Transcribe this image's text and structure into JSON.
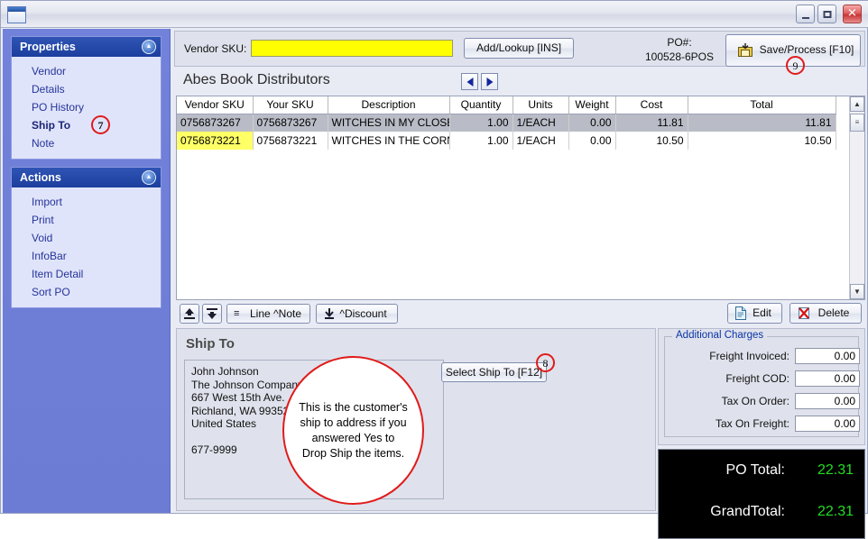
{
  "titlebar": {
    "minimize_label": "_",
    "maximize_label": "",
    "close_label": "✕"
  },
  "sidebar": {
    "properties": {
      "header": "Properties",
      "items": [
        {
          "label": "Vendor",
          "selected": false
        },
        {
          "label": "Details",
          "selected": false
        },
        {
          "label": "PO History",
          "selected": false
        },
        {
          "label": "Ship To",
          "selected": true,
          "badge": "7"
        },
        {
          "label": "Note",
          "selected": false
        }
      ]
    },
    "actions": {
      "header": "Actions",
      "items": [
        {
          "label": "Import"
        },
        {
          "label": "Print"
        },
        {
          "label": "Void"
        },
        {
          "label": "InfoBar"
        },
        {
          "label": "Item Detail"
        },
        {
          "label": "Sort PO"
        }
      ]
    }
  },
  "topbar": {
    "vendor_sku_label": "Vendor SKU:",
    "vendor_sku_value": "",
    "add_lookup_label": "Add/Lookup [INS]",
    "po_number_label": "PO#:",
    "po_number_value": "100528-6POS",
    "save_process_label": "Save/Process [F10]",
    "save_badge": "9"
  },
  "vendor": {
    "name": "Abes Book Distributors",
    "prev_label": "◀",
    "next_label": "▶"
  },
  "grid": {
    "columns": [
      "Vendor SKU",
      "Your SKU",
      "Description",
      "Quantity",
      "Units",
      "Weight",
      "Cost",
      "Total"
    ],
    "rows": [
      {
        "vendor_sku": "0756873267",
        "your_sku": "0756873267",
        "description": "WITCHES IN MY CLOSET",
        "quantity": "1.00",
        "units": "1/EACH",
        "weight": "0.00",
        "cost": "11.81",
        "total": "11.81",
        "selected": true,
        "sku_highlight": "cyan"
      },
      {
        "vendor_sku": "0756873221",
        "your_sku": "0756873221",
        "description": "WITCHES IN THE CORN F",
        "quantity": "1.00",
        "units": "1/EACH",
        "weight": "0.00",
        "cost": "10.50",
        "total": "10.50",
        "selected": false,
        "sku_highlight": "yellow"
      }
    ],
    "scroll_up": "▲",
    "scroll_down": "▼",
    "scroll_thumb": "≡"
  },
  "grid_toolbar": {
    "move_up_label": "",
    "move_down_label": "",
    "line_note_label": "Line ^Note",
    "line_note_glyph": "≡",
    "discount_label": "^Discount",
    "discount_glyph": "↓",
    "edit_label": "Edit",
    "edit_glyph": "❐",
    "delete_label": "Delete",
    "delete_glyph": "✖"
  },
  "shipto": {
    "title": "Ship To",
    "address_lines": [
      "John Johnson",
      "The Johnson Company",
      "667 West 15th Ave.",
      "Richland, WA     99352",
      "United States",
      "",
      "677-9999"
    ],
    "select_button_label": "Select Ship To [F12]",
    "select_badge": "8",
    "callout_text": "This is the customer's ship to address if you answered Yes to Drop Ship the items."
  },
  "charges": {
    "legend": "Additional Charges",
    "rows": [
      {
        "label": "Freight Invoiced:",
        "value": "0.00"
      },
      {
        "label": "Freight COD:",
        "value": "0.00"
      },
      {
        "label": "Tax On Order:",
        "value": "0.00"
      },
      {
        "label": "Tax On Freight:",
        "value": "0.00"
      }
    ]
  },
  "totals": {
    "rows": [
      {
        "label": "PO Total:",
        "value": "22.31"
      },
      {
        "label": "GrandTotal:",
        "value": "22.31"
      }
    ]
  }
}
